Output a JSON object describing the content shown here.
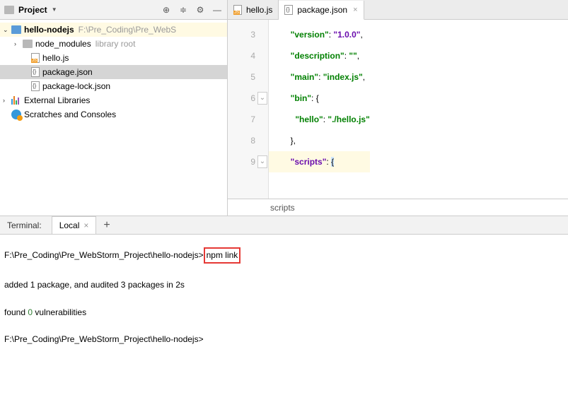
{
  "sidebar": {
    "title": "Project",
    "tree": {
      "root": {
        "name": "hello-nodejs",
        "path": "F:\\Pre_Coding\\Pre_WebS"
      },
      "node_modules": {
        "name": "node_modules",
        "hint": "library root"
      },
      "hello_js": "hello.js",
      "package_json": "package.json",
      "package_lock": "package-lock.json",
      "ext_lib": "External Libraries",
      "scratches": "Scratches and Consoles"
    }
  },
  "tabs": {
    "t1": "hello.js",
    "t2": "package.json"
  },
  "code": {
    "l3": {
      "key": "\"version\"",
      "val": "\"1.0.0\""
    },
    "l4": {
      "key": "\"description\"",
      "val": "\"\""
    },
    "l5": {
      "key": "\"main\"",
      "val": "\"index.js\""
    },
    "l6": {
      "key": "\"bin\""
    },
    "l7": {
      "key": "\"hello\"",
      "val": "\"./hello.js\""
    },
    "l9": {
      "key": "\"scripts\""
    },
    "lines": [
      "3",
      "4",
      "5",
      "6",
      "7",
      "8",
      "9"
    ]
  },
  "breadcrumb": "scripts",
  "terminal": {
    "title": "Terminal:",
    "tab": "Local",
    "prompt1_path": "F:\\Pre_Coding\\Pre_WebStorm_Project\\hello-nodejs>",
    "cmd": "npm link",
    "out1": "added 1 package, and audited 3 packages in 2s",
    "out2_a": "found ",
    "out2_b": "0",
    "out2_c": " vulnerabilities",
    "prompt2": "F:\\Pre_Coding\\Pre_WebStorm_Project\\hello-nodejs>"
  }
}
